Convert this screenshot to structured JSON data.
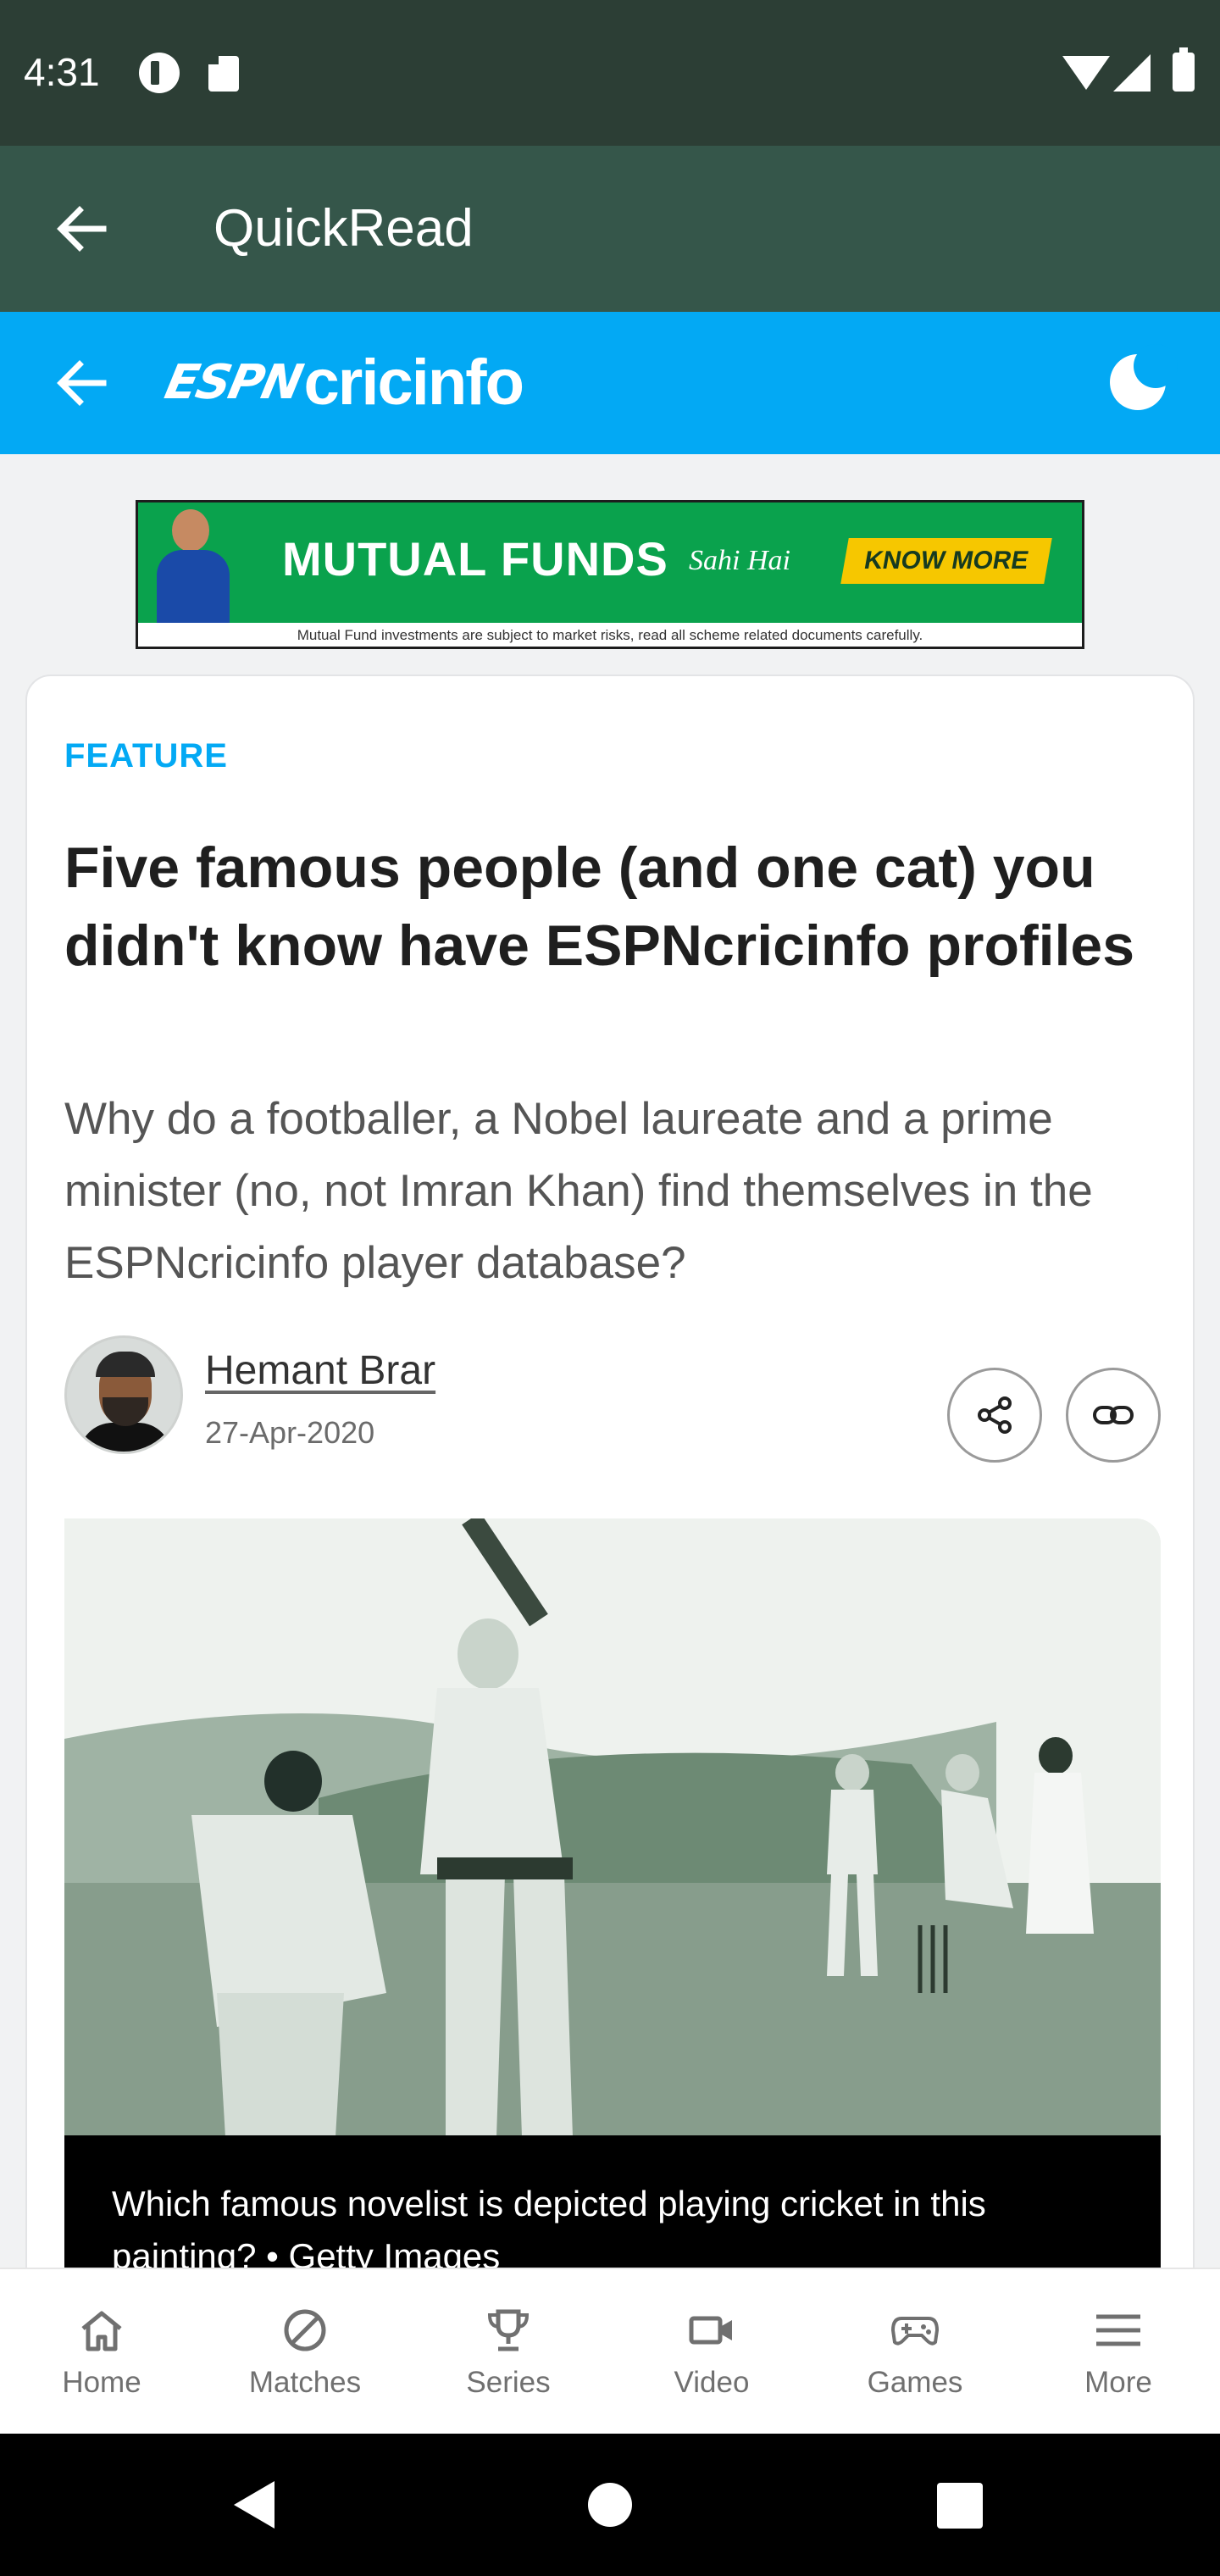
{
  "status_bar": {
    "time": "4:31"
  },
  "app_header": {
    "title": "QuickRead"
  },
  "espn_bar": {
    "logo_espn": "ESPN",
    "logo_cricinfo": "cricinfo"
  },
  "ad": {
    "title": "MUTUAL FUNDS",
    "tagline": "Sahi Hai",
    "cta": "KNOW MORE",
    "disclaimer": "Mutual Fund investments are subject to market risks, read all scheme related documents carefully."
  },
  "article": {
    "kicker": "FEATURE",
    "headline": "Five famous people (and one cat) you didn't know have ESPNcricinfo profiles",
    "summary": "Why do a footballer, a Nobel laureate and a prime minister (no, not Imran Khan) find themselves in the ESPNcricinfo player database?",
    "author_name": "Hemant Brar",
    "date": "27-Apr-2020",
    "caption": "Which famous novelist is depicted playing cricket in this painting? • Getty Images"
  },
  "bottom_nav": {
    "items": [
      {
        "label": "Home",
        "icon": "home-icon"
      },
      {
        "label": "Matches",
        "icon": "matches-icon"
      },
      {
        "label": "Series",
        "icon": "trophy-icon"
      },
      {
        "label": "Video",
        "icon": "video-icon"
      },
      {
        "label": "Games",
        "icon": "gamepad-icon"
      },
      {
        "label": "More",
        "icon": "menu-icon"
      }
    ]
  },
  "colors": {
    "status_bar": "#2c3e35",
    "app_header": "#35564a",
    "espn_blue": "#03a9f4",
    "ad_green": "#0aa24d"
  }
}
